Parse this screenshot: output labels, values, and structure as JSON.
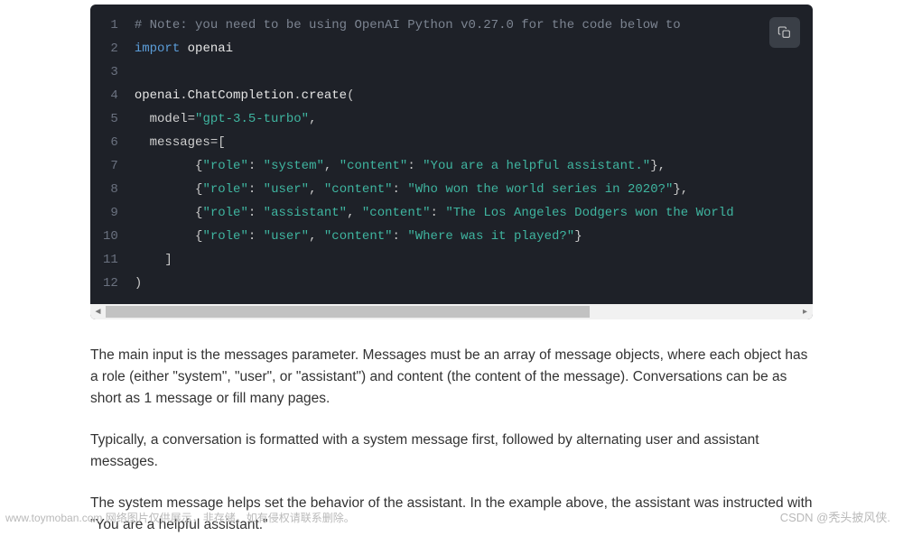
{
  "code": {
    "line_count": 12,
    "lines": [
      [
        {
          "cls": "tok-comment",
          "t": "# Note: you need to be using OpenAI Python v0.27.0 for the code below to "
        }
      ],
      [
        {
          "cls": "tok-keyword",
          "t": "import"
        },
        {
          "cls": "",
          "t": " "
        },
        {
          "cls": "tok-ident",
          "t": "openai"
        }
      ],
      [],
      [
        {
          "cls": "tok-ident",
          "t": "openai"
        },
        {
          "cls": "tok-punct",
          "t": "."
        },
        {
          "cls": "tok-ident",
          "t": "ChatCompletion"
        },
        {
          "cls": "tok-punct",
          "t": "."
        },
        {
          "cls": "tok-func",
          "t": "create"
        },
        {
          "cls": "tok-punct",
          "t": "("
        }
      ],
      [
        {
          "cls": "",
          "t": "  "
        },
        {
          "cls": "tok-param",
          "t": "model"
        },
        {
          "cls": "tok-punct",
          "t": "="
        },
        {
          "cls": "tok-string",
          "t": "\"gpt-3.5-turbo\""
        },
        {
          "cls": "tok-punct",
          "t": ","
        }
      ],
      [
        {
          "cls": "",
          "t": "  "
        },
        {
          "cls": "tok-param",
          "t": "messages"
        },
        {
          "cls": "tok-punct",
          "t": "=["
        }
      ],
      [
        {
          "cls": "",
          "t": "        "
        },
        {
          "cls": "tok-punct",
          "t": "{"
        },
        {
          "cls": "tok-string",
          "t": "\"role\""
        },
        {
          "cls": "tok-punct",
          "t": ": "
        },
        {
          "cls": "tok-string",
          "t": "\"system\""
        },
        {
          "cls": "tok-punct",
          "t": ", "
        },
        {
          "cls": "tok-string",
          "t": "\"content\""
        },
        {
          "cls": "tok-punct",
          "t": ": "
        },
        {
          "cls": "tok-string",
          "t": "\"You are a helpful assistant.\""
        },
        {
          "cls": "tok-punct",
          "t": "},"
        }
      ],
      [
        {
          "cls": "",
          "t": "        "
        },
        {
          "cls": "tok-punct",
          "t": "{"
        },
        {
          "cls": "tok-string",
          "t": "\"role\""
        },
        {
          "cls": "tok-punct",
          "t": ": "
        },
        {
          "cls": "tok-string",
          "t": "\"user\""
        },
        {
          "cls": "tok-punct",
          "t": ", "
        },
        {
          "cls": "tok-string",
          "t": "\"content\""
        },
        {
          "cls": "tok-punct",
          "t": ": "
        },
        {
          "cls": "tok-string",
          "t": "\"Who won the world series in 2020?\""
        },
        {
          "cls": "tok-punct",
          "t": "},"
        }
      ],
      [
        {
          "cls": "",
          "t": "        "
        },
        {
          "cls": "tok-punct",
          "t": "{"
        },
        {
          "cls": "tok-string",
          "t": "\"role\""
        },
        {
          "cls": "tok-punct",
          "t": ": "
        },
        {
          "cls": "tok-string",
          "t": "\"assistant\""
        },
        {
          "cls": "tok-punct",
          "t": ", "
        },
        {
          "cls": "tok-string",
          "t": "\"content\""
        },
        {
          "cls": "tok-punct",
          "t": ": "
        },
        {
          "cls": "tok-string",
          "t": "\"The Los Angeles Dodgers won the World"
        }
      ],
      [
        {
          "cls": "",
          "t": "        "
        },
        {
          "cls": "tok-punct",
          "t": "{"
        },
        {
          "cls": "tok-string",
          "t": "\"role\""
        },
        {
          "cls": "tok-punct",
          "t": ": "
        },
        {
          "cls": "tok-string",
          "t": "\"user\""
        },
        {
          "cls": "tok-punct",
          "t": ", "
        },
        {
          "cls": "tok-string",
          "t": "\"content\""
        },
        {
          "cls": "tok-punct",
          "t": ": "
        },
        {
          "cls": "tok-string",
          "t": "\"Where was it played?\""
        },
        {
          "cls": "tok-punct",
          "t": "}"
        }
      ],
      [
        {
          "cls": "",
          "t": "    "
        },
        {
          "cls": "tok-punct",
          "t": "]"
        }
      ],
      [
        {
          "cls": "tok-punct",
          "t": ")"
        }
      ]
    ]
  },
  "paragraphs": {
    "p1": "The main input is the messages parameter. Messages must be an array of message objects, where each object has a role (either \"system\", \"user\", or \"assistant\") and content (the content of the message). Conversations can be as short as 1 message or fill many pages.",
    "p2": "Typically, a conversation is formatted with a system message first, followed by alternating user and assistant messages.",
    "p3": "The system message helps set the behavior of the assistant. In the example above, the assistant was instructed with \"You are a helpful assistant.\""
  },
  "watermarks": {
    "left": "www.toymoban.com  网络图片仅供展示，非存储，如有侵权请联系删除。",
    "right": "CSDN @秃头披风侠."
  }
}
